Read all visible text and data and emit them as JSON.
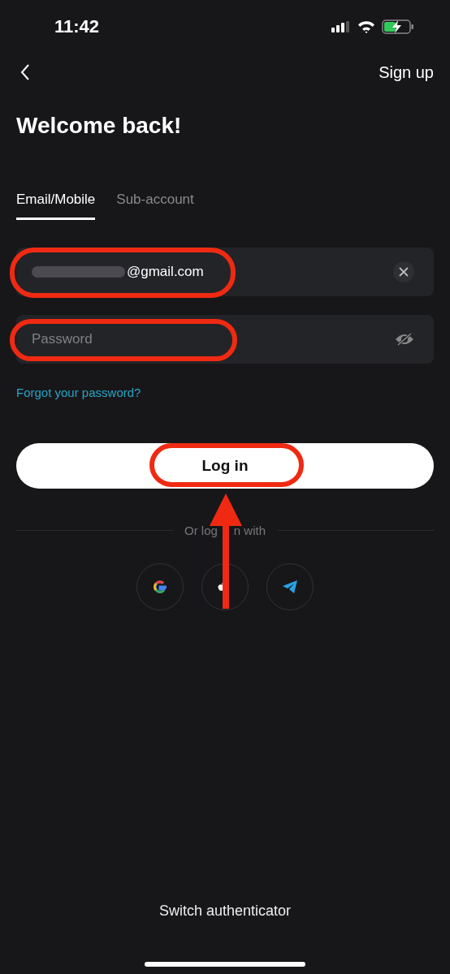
{
  "status_bar": {
    "time": "11:42"
  },
  "nav": {
    "action": "Sign up"
  },
  "title": "Welcome back!",
  "tabs": [
    {
      "label": "Email/Mobile",
      "selected": true
    },
    {
      "label": "Sub-account",
      "selected": false
    }
  ],
  "email": {
    "value": "@gmail.com",
    "redacted": true
  },
  "password": {
    "placeholder": "Password"
  },
  "forgot_link": "Forgot your password?",
  "login_button": "Log in",
  "divider_text": [
    "Or log",
    "n with"
  ],
  "social": [
    {
      "kind": "google"
    },
    {
      "kind": "apple"
    },
    {
      "kind": "telegram"
    }
  ],
  "footer_link": "Switch authenticator"
}
